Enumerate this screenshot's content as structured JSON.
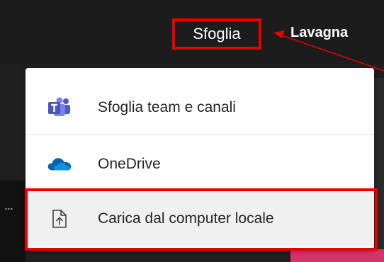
{
  "header": {
    "sfoglia_label": "Sfoglia",
    "lavagna_label": "Lavagna"
  },
  "menu": {
    "items": [
      {
        "label": "Sfoglia team e canali",
        "icon": "teams-icon"
      },
      {
        "label": "OneDrive",
        "icon": "onedrive-icon"
      },
      {
        "label": "Carica dal computer locale",
        "icon": "upload-file-icon"
      }
    ]
  },
  "background": {
    "overflow_dots": "..."
  },
  "colors": {
    "highlight": "#e60000",
    "teams": "#5059c9",
    "onedrive": "#0364b8",
    "dark_bg": "#1c1c1c"
  }
}
